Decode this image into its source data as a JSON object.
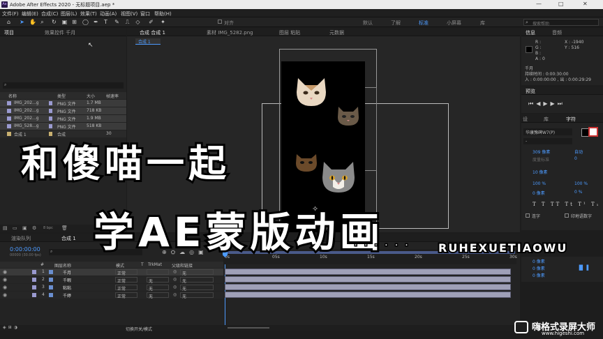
{
  "window": {
    "title": "Adobe After Effects 2020 - 无标题项目.aep *",
    "logo": "Ae",
    "min": "—",
    "max": "□",
    "close": "✕"
  },
  "menu": [
    "文件(F)",
    "编辑(E)",
    "合成(C)",
    "图层(L)",
    "效果(T)",
    "动画(A)",
    "视图(V)",
    "窗口",
    "帮助(H)"
  ],
  "toolbar": {
    "align": "对齐",
    "workspaces": [
      "默认",
      "了解",
      "标准",
      "小屏幕",
      "库"
    ],
    "search_placeholder": "搜索帮助"
  },
  "project": {
    "tabs": [
      "项目",
      "效果控件 千月"
    ],
    "search": "",
    "columns": [
      "名称",
      "类型",
      "大小",
      "帧速率"
    ],
    "items": [
      {
        "name": "IMG_202...g",
        "type": "PNG 文件",
        "size": "1.7 MB",
        "color": "#9a9ad0"
      },
      {
        "name": "IMG_202...g",
        "type": "PNG 文件",
        "size": "718 KB",
        "color": "#9a9ad0"
      },
      {
        "name": "IMG_202...g",
        "type": "PNG 文件",
        "size": "1.9 MB",
        "color": "#9a9ad0"
      },
      {
        "name": "IMG_528...g",
        "type": "PNG 文件",
        "size": "518 KB",
        "color": "#9a9ad0"
      },
      {
        "name": "合成 1",
        "type": "合成",
        "size": "",
        "fps": "30",
        "color": "#c8b070"
      }
    ],
    "bpc": "8 bpc"
  },
  "viewer": {
    "tabs": [
      "合成 合成 1",
      "素材 IMG_5282.png",
      "图层 粘贴",
      "元数据"
    ],
    "crumb": "合成 1",
    "bottom_label": "机"
  },
  "info": {
    "tabs": [
      "信息",
      "音频"
    ],
    "R": "R :",
    "G": "G :",
    "B": "B :",
    "A": "A : 0",
    "X": "X : -1940",
    "Y": "Y : 516",
    "layer": "千月",
    "dur": "持续时间 : 0:00:30:00",
    "range": "入 : 0:00:00:00 , 出 : 0:00:29:29"
  },
  "preview": {
    "title": "预览"
  },
  "char": {
    "tabs": [
      "设",
      "库",
      "字符"
    ],
    "font": "华康豫碑W7(P)",
    "style": "-",
    "size": "309 像素",
    "leading": "自动",
    "kerning": "度量标准",
    "tracking": "0",
    "stroke": "10 像素",
    "stroke_mode": "",
    "vscale": "100 %",
    "hscale": "100 %",
    "baseline": "0 像素",
    "tsume": "0 %",
    "styles": [
      "T",
      "T",
      "TT",
      "Tt",
      "T¹",
      "T₁"
    ],
    "ligature": "连字",
    "hindi": "印地语数字"
  },
  "align": {
    "vals": [
      "0 像素",
      "0 像素",
      "0 像素"
    ]
  },
  "timeline": {
    "tabs": [
      "渲染队列",
      "合成 1"
    ],
    "timecode": "0:00:00:00",
    "tc_sub": "00000 (30.00 fps)",
    "cols": [
      "#",
      "图层名称",
      "模式",
      "T",
      "TrkMat",
      "父级和链接"
    ],
    "ruler": [
      "0s",
      "05s",
      "10s",
      "15s",
      "20s",
      "25s",
      "30s"
    ],
    "layers": [
      {
        "num": "1",
        "name": "千月",
        "mode": "正常",
        "trk": "",
        "parent": "无"
      },
      {
        "num": "2",
        "name": "千暇",
        "mode": "正常",
        "trk": "无",
        "parent": "无"
      },
      {
        "num": "3",
        "name": "粘粘",
        "mode": "正常",
        "trk": "无",
        "parent": "无"
      },
      {
        "num": "4",
        "name": "千婷",
        "mode": "正常",
        "trk": "无",
        "parent": "无"
      }
    ],
    "switch_label": "切换开关/模式"
  },
  "overlay": {
    "line1": "和傻喵一起",
    "line2": "学AE蒙版动画",
    "site": "RUHEXUETIAOWU",
    "dots": ". . . . . ."
  },
  "watermark": {
    "brand": "嗨格式录屏大师",
    "url": "www.higeshi.com"
  }
}
